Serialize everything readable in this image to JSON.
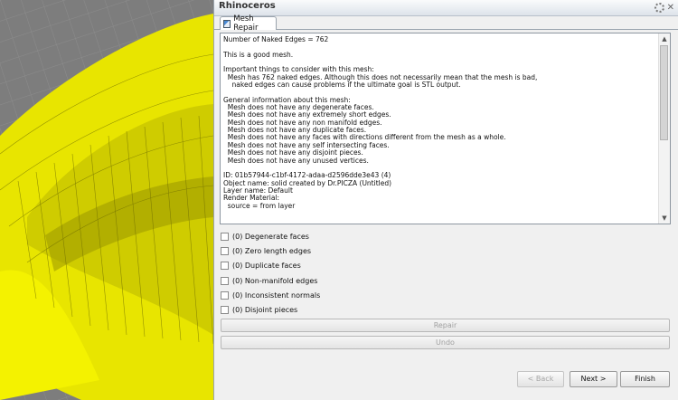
{
  "panel": {
    "title": "Rhinoceros",
    "tab_label": "Mesh Repair",
    "icons": [
      "gear-icon",
      "close-icon",
      "mesh-repair-icon"
    ]
  },
  "report": {
    "lines": [
      "Number of Naked Edges = 762",
      "",
      "This is a good mesh.",
      "",
      "Important things to consider with this mesh:",
      "  Mesh has 762 naked edges. Although this does not necessarily mean that the mesh is bad,",
      "    naked edges can cause problems if the ultimate goal is STL output.",
      "",
      "General information about this mesh:",
      "  Mesh does not have any degenerate faces.",
      "  Mesh does not have any extremely short edges.",
      "  Mesh does not have any non manifold edges.",
      "  Mesh does not have any duplicate faces.",
      "  Mesh does not have any faces with directions different from the mesh as a whole.",
      "  Mesh does not have any self intersecting faces.",
      "  Mesh does not have any disjoint pieces.",
      "  Mesh does not have any unused vertices.",
      "",
      "ID: 01b57944-c1bf-4172-adaa-d2596dde3e43 (4)",
      "Object name: solid created by Dr.PICZA (Untitled)",
      "Layer name: Default",
      "Render Material:",
      "  source = from layer"
    ]
  },
  "checks": [
    {
      "label": "(0) Degenerate faces"
    },
    {
      "label": "(0) Zero length edges"
    },
    {
      "label": "(0) Duplicate faces"
    },
    {
      "label": "(0) Non-manifold edges"
    },
    {
      "label": "(0) Inconsistent normals"
    },
    {
      "label": "(0) Disjoint pieces"
    }
  ],
  "buttons": {
    "repair": "Repair",
    "undo": "Undo",
    "back": "< Back",
    "next": "Next >",
    "finish": "Finish"
  },
  "colors": {
    "mesh": "#f2ef00",
    "viewport_bg": "#7f7f7f",
    "panel_bg": "#f0f0f0"
  }
}
